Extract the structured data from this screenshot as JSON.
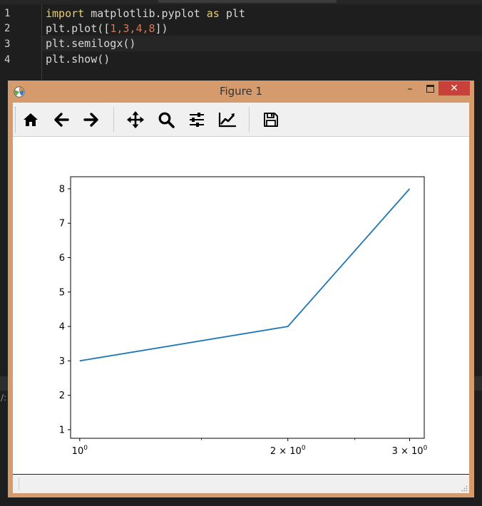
{
  "editor": {
    "line_numbers": [
      "1",
      "2",
      "3",
      "4"
    ],
    "lines": {
      "l1": {
        "kw1": "import",
        "mid": " matplotlib.pyplot ",
        "kw2": "as",
        "end": " plt"
      },
      "l2": {
        "pre": "plt.plot([",
        "n1": "1",
        "c1": ",",
        "n2": "3",
        "c2": ",",
        "n3": "4",
        "c3": ",",
        "n4": "8",
        "post": "])"
      },
      "l3": {
        "text": "plt.semilogx()"
      },
      "l4": {
        "text": "plt.show()"
      }
    },
    "bottom_glyph": "/:"
  },
  "window": {
    "title": "Figure 1",
    "minimize_label": "–",
    "close_label": "✕"
  },
  "toolbar": {
    "icons": [
      "home-icon",
      "back-arrow-icon",
      "forward-arrow-icon",
      "move-icon",
      "zoom-icon",
      "configure-subplots-icon",
      "edit-axes-icon",
      "save-icon"
    ]
  },
  "colors": {
    "window_border": "#d59b6d",
    "close_button": "#c7403a",
    "series_line": "#1f77b4",
    "keyword": "#e6cf76",
    "number_literal": "#d2784c"
  },
  "chart_data": {
    "type": "line",
    "x_scale": "log",
    "x": [
      1,
      2,
      3
    ],
    "series": [
      {
        "values": [
          3,
          4,
          8
        ]
      }
    ],
    "xlim": [
      0.97,
      3.15
    ],
    "ylim": [
      0.75,
      8.35
    ],
    "y_ticks": [
      {
        "value": 1,
        "label": "1"
      },
      {
        "value": 2,
        "label": "2"
      },
      {
        "value": 3,
        "label": "3"
      },
      {
        "value": 4,
        "label": "4"
      },
      {
        "value": 5,
        "label": "5"
      },
      {
        "value": 6,
        "label": "6"
      },
      {
        "value": 7,
        "label": "7"
      },
      {
        "value": 8,
        "label": "8"
      }
    ],
    "x_ticks": [
      {
        "value": 1,
        "label": "10",
        "sup": "0"
      },
      {
        "value": 2,
        "label": "2 × 10",
        "sup": "0"
      },
      {
        "value": 3,
        "label": "3 × 10",
        "sup": "0"
      }
    ],
    "grid": false,
    "title": "",
    "xlabel": "",
    "ylabel": ""
  }
}
